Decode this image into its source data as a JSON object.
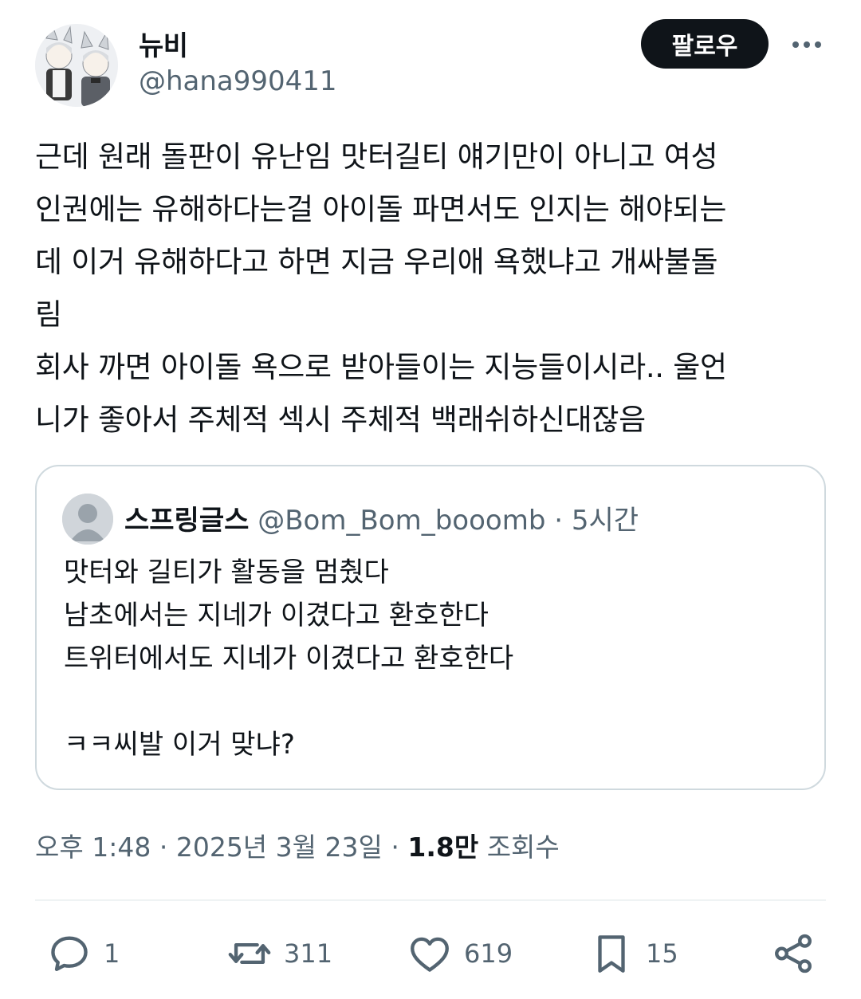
{
  "author": {
    "display_name": "뉴비",
    "handle": "@hana990411",
    "avatar_icon": "profile-avatar-illustration"
  },
  "header": {
    "follow_label": "팔로우",
    "more_icon": "more-icon"
  },
  "tweet": {
    "text": "근데 원래 돌판이 유난임 맛터길티 얘기만이 아니고 여성\n인권에는 유해하다는걸 아이돌 파면서도 인지는 해야되는\n데 이거 유해하다고 하면 지금 우리애 욕했냐고 개싸불돌\n림\n회사 까면 아이돌 욕으로 받아들이는 지능들이시라.. 울언\n니가 좋아서 주체적 섹시 주체적 백래쉬하신대잖음"
  },
  "quote": {
    "display_name": "스프링글스",
    "handle": "@Bom_Bom_booomb",
    "separator": "·",
    "time": "5시간",
    "text": "맛터와 길티가 활동을 멈췄다\n남초에서는 지네가 이겼다고 환호한다\n트위터에서도 지네가 이겼다고 환호한다\n\nㅋㅋ씨발 이거 맞냐?"
  },
  "meta": {
    "time": "오후 1:48",
    "sep1": "·",
    "date": "2025년 3월 23일",
    "sep2": "·",
    "views_count": "1.8만",
    "views_label": "조회수"
  },
  "actions": {
    "reply_count": "1",
    "retweet_count": "311",
    "like_count": "619",
    "bookmark_count": "15"
  },
  "colors": {
    "text_primary": "#0f1419",
    "text_secondary": "#536471",
    "border": "#cfd9de",
    "button_bg": "#0f1419"
  }
}
